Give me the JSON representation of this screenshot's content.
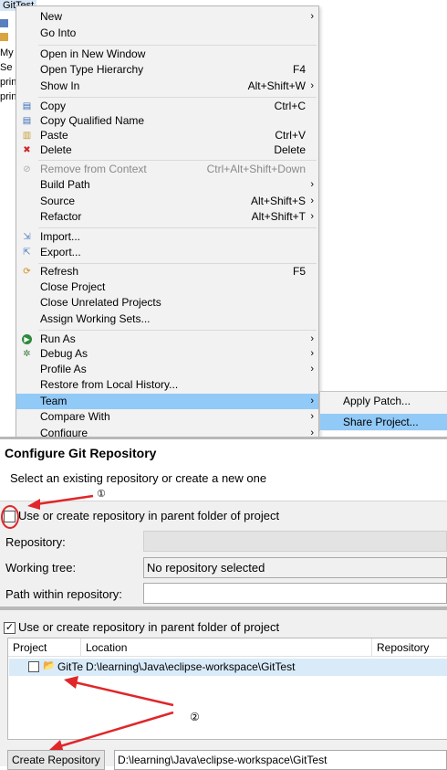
{
  "tree": {
    "title": "GitTest",
    "rows": [
      "",
      "",
      "My",
      "Se",
      "prin",
      "prin"
    ]
  },
  "menu": {
    "items": [
      {
        "label": "New",
        "accel": "",
        "submenu": true
      },
      {
        "label": "Go Into",
        "accel": "",
        "submenu": false
      },
      {
        "label": "Open in New Window",
        "accel": "",
        "submenu": false
      },
      {
        "label": "Open Type Hierarchy",
        "accel": "F4",
        "submenu": false
      },
      {
        "label": "Show In",
        "accel": "Alt+Shift+W",
        "submenu": true
      },
      {
        "label": "Copy",
        "accel": "Ctrl+C",
        "submenu": false
      },
      {
        "label": "Copy Qualified Name",
        "accel": "",
        "submenu": false
      },
      {
        "label": "Paste",
        "accel": "Ctrl+V",
        "submenu": false
      },
      {
        "label": "Delete",
        "accel": "Delete",
        "submenu": false
      },
      {
        "label": "Remove from Context",
        "accel": "Ctrl+Alt+Shift+Down",
        "submenu": false
      },
      {
        "label": "Build Path",
        "accel": "",
        "submenu": true
      },
      {
        "label": "Source",
        "accel": "Alt+Shift+S",
        "submenu": true
      },
      {
        "label": "Refactor",
        "accel": "Alt+Shift+T",
        "submenu": true
      },
      {
        "label": "Import...",
        "accel": "",
        "submenu": false
      },
      {
        "label": "Export...",
        "accel": "",
        "submenu": false
      },
      {
        "label": "Refresh",
        "accel": "F5",
        "submenu": false
      },
      {
        "label": "Close Project",
        "accel": "",
        "submenu": false
      },
      {
        "label": "Close Unrelated Projects",
        "accel": "",
        "submenu": false
      },
      {
        "label": "Assign Working Sets...",
        "accel": "",
        "submenu": false
      },
      {
        "label": "Run As",
        "accel": "",
        "submenu": true
      },
      {
        "label": "Debug As",
        "accel": "",
        "submenu": true
      },
      {
        "label": "Profile As",
        "accel": "",
        "submenu": true
      },
      {
        "label": "Restore from Local History...",
        "accel": "",
        "submenu": false
      },
      {
        "label": "Team",
        "accel": "",
        "submenu": true
      },
      {
        "label": "Compare With",
        "accel": "",
        "submenu": true
      },
      {
        "label": "Configure",
        "accel": "",
        "submenu": true
      }
    ],
    "submenu": [
      "Apply Patch...",
      "Share Project..."
    ],
    "arrow": "›"
  },
  "config": {
    "title": "Configure Git Repository",
    "description": "Select an existing repository or create a new one",
    "use_parent_label": "Use or create repository in parent folder of project",
    "repository_label": "Repository:",
    "repository_value": "",
    "working_tree_label": "Working tree:",
    "working_tree_value": "No repository selected",
    "path_label": "Path within repository:",
    "path_value": "",
    "annotation_1": "①",
    "annotation_color": "#e0262a"
  },
  "bottom": {
    "use_parent_label": "Use or create repository in parent folder of project",
    "columns": [
      "Project",
      "Location",
      "Repository"
    ],
    "row": {
      "project": "GitTe",
      "location": "D:\\learning\\Java\\eclipse-workspace\\GitTest"
    },
    "annotation_2": "②",
    "create_button": "Create Repository",
    "create_path": "D:\\learning\\Java\\eclipse-workspace\\GitTest"
  }
}
